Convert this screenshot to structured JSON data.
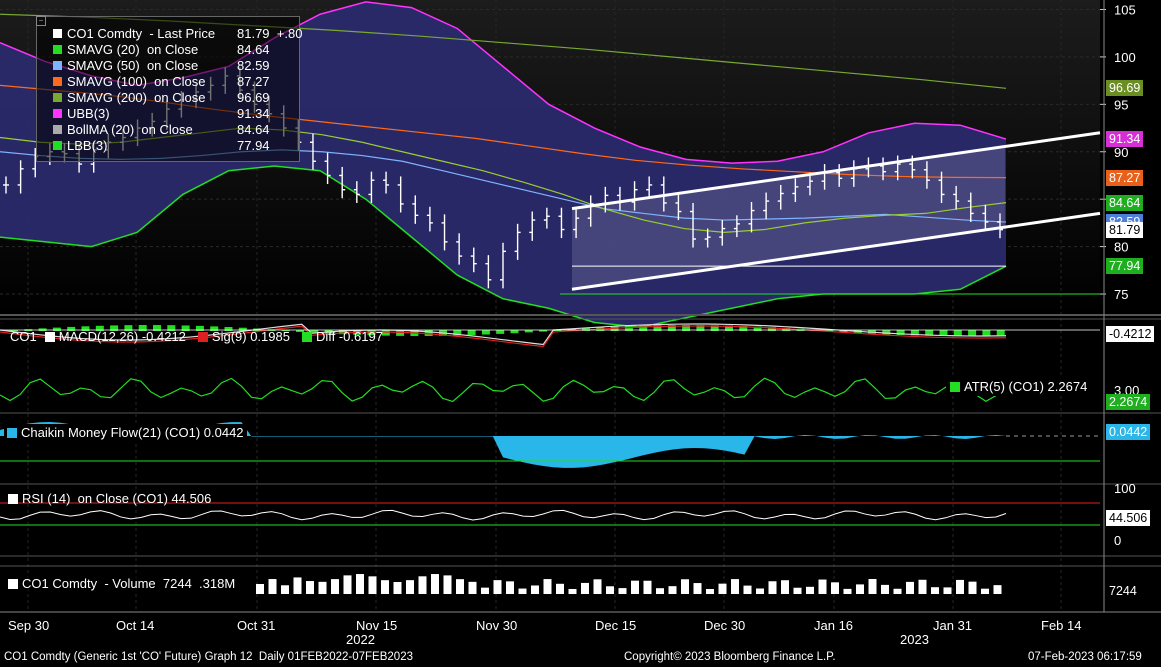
{
  "legend": [
    {
      "label": "CO1 Comdty  - Last Price",
      "value": "81.79  +.80",
      "color": "#ffffff"
    },
    {
      "label": "SMAVG (20)  on Close",
      "value": "84.64",
      "color": "#22dd22"
    },
    {
      "label": "SMAVG (50)  on Close",
      "value": "82.59",
      "color": "#7fb3ff"
    },
    {
      "label": "SMAVG (100)  on Close",
      "value": "87.27",
      "color": "#ff6a1a"
    },
    {
      "label": "SMAVG (200)  on Close",
      "value": "96.69",
      "color": "#78a832"
    },
    {
      "label": "UBB(3)",
      "value": "91.34",
      "color": "#ff33ff"
    },
    {
      "label": "BollMA (20)  on Close",
      "value": "84.64",
      "color": "#aaaaaa"
    },
    {
      "label": "LBB(3)",
      "value": "77.94",
      "color": "#22dd22"
    }
  ],
  "price_axis": {
    "ticks": [
      "105",
      "100",
      "95",
      "90",
      "85",
      "80",
      "75"
    ]
  },
  "price_tags": [
    {
      "text": "96.69",
      "bg": "#6b8e23",
      "fg": "#ffffff",
      "value": 96.69
    },
    {
      "text": "91.34",
      "bg": "#d62fd6",
      "fg": "#ffffff",
      "value": 91.34
    },
    {
      "text": "87.27",
      "bg": "#e8601a",
      "fg": "#ffffff",
      "value": 87.27
    },
    {
      "text": "84.64",
      "bg": "#1fae1f",
      "fg": "#ffffff",
      "value": 84.64
    },
    {
      "text": "82.59",
      "bg": "#4d7fd6",
      "fg": "#ffffff",
      "value": 82.59
    },
    {
      "text": "81.79",
      "bg": "#ffffff",
      "fg": "#000000",
      "value": 81.79
    },
    {
      "text": "77.94",
      "bg": "#1fae1f",
      "fg": "#ffffff",
      "value": 77.94
    }
  ],
  "macd": {
    "label_series": "CO1",
    "label_macd": "MACD(12,26) -0.4212",
    "label_sig": "Sig(9) 0.1985",
    "label_diff": "Diff -0.6197",
    "tag": "-0.4212"
  },
  "atr": {
    "label": "ATR(5) (CO1) 2.2674",
    "tag": "2.2674",
    "tick": "3.00"
  },
  "cmf": {
    "label": "Chaikin Money Flow(21) (CO1) 0.0442",
    "tag": "0.0442"
  },
  "rsi": {
    "label": "RSI (14)  on Close (CO1) 44.506",
    "tag": "44.506",
    "ticks": [
      "100",
      "50",
      "0"
    ]
  },
  "volume": {
    "label": "CO1 Comdty  - Volume  7244  .318M",
    "tag": "7244"
  },
  "x_axis": {
    "ticks": [
      "Sep 30",
      "Oct 14",
      "Oct 31",
      "Nov 15",
      "Nov 30",
      "Dec 15",
      "Dec 30",
      "Jan 16",
      "Jan 31",
      "Feb 14"
    ],
    "years": [
      "2022",
      "2023"
    ]
  },
  "footer": {
    "left": "CO1 Comdty (Generic 1st 'CO' Future) Graph 12  Daily 01FEB2022-07FEB2023",
    "center": "Copyright© 2023 Bloomberg Finance L.P.",
    "right": "07-Feb-2023 06:17:59"
  },
  "colors": {
    "band_fill": "#2b2a6b",
    "ubb": "#ff33ff",
    "lbb": "#22dd22",
    "sma50": "#7fb3ff",
    "sma100": "#ff6a1a",
    "sma200": "#78a832",
    "sma20": "#9acd32",
    "channel": "#ffffff",
    "cmf": "#29b6e8"
  },
  "chart_data": {
    "type": "candlestick",
    "x_dates": [
      "Sep 30",
      "Oct 14",
      "Oct 31",
      "Nov 15",
      "Nov 30",
      "Dec 15",
      "Dec 30",
      "Jan 16",
      "Jan 31",
      "Feb 14"
    ],
    "y_range": [
      73,
      106
    ],
    "close": [
      86.5,
      88.2,
      89.5,
      90.0,
      89.8,
      88.7,
      90.2,
      91.0,
      91.5,
      92.5,
      93.2,
      94.5,
      95.5,
      96.3,
      97.0,
      98.0,
      96.5,
      95.0,
      94.0,
      92.5,
      91.0,
      89.0,
      87.5,
      86.0,
      85.5,
      87.0,
      86.5,
      84.5,
      83.3,
      82.5,
      80.5,
      79.0,
      78.2,
      76.5,
      79.5,
      81.5,
      82.8,
      83.2,
      81.8,
      83.0,
      84.5,
      85.4,
      84.7,
      86.0,
      86.5,
      84.6,
      83.7,
      80.8,
      81.0,
      81.9,
      82.4,
      83.8,
      84.8,
      85.6,
      86.3,
      86.9,
      87.8,
      87.2,
      88.2,
      88.5,
      87.9,
      88.7,
      88.1,
      87.0,
      85.5,
      84.8,
      83.5,
      82.6,
      81.79
    ],
    "sma20": [
      91.5,
      91.0,
      90.8,
      91.0,
      91.5,
      92.0,
      92.5,
      92.3,
      91.8,
      91.0,
      90.0,
      89.0,
      88.0,
      86.8,
      85.5,
      84.0,
      82.8,
      81.9,
      81.5,
      81.8,
      82.5,
      83.0,
      83.3,
      83.5,
      84.1,
      84.64
    ],
    "sma50": [
      90.0,
      89.6,
      89.3,
      89.2,
      89.3,
      89.6,
      90.0,
      90.2,
      90.0,
      89.6,
      89.0,
      88.0,
      87.0,
      86.0,
      85.0,
      84.0,
      83.5,
      83.0,
      82.8,
      82.9,
      83.0,
      83.2,
      83.4,
      83.1,
      82.8,
      82.59
    ],
    "sma100": [
      97.0,
      96.5,
      96.0,
      95.3,
      94.5,
      93.8,
      93.2,
      92.6,
      92.0,
      91.4,
      90.6,
      89.8,
      89.1,
      88.6,
      88.2,
      87.9,
      87.6,
      87.4,
      87.3,
      87.27
    ],
    "sma200": [
      104.5,
      104.2,
      103.8,
      103.3,
      102.8,
      102.2,
      101.5,
      100.8,
      100.0,
      99.2,
      98.4,
      97.6,
      96.69
    ],
    "ubb": [
      101.5,
      99.5,
      98.0,
      97.0,
      97.8,
      99.0,
      102.0,
      104.5,
      105.8,
      105.2,
      103.0,
      99.0,
      95.0,
      92.5,
      90.5,
      89.2,
      88.8,
      89.0,
      90.0,
      92.0,
      93.0,
      92.8,
      91.34
    ],
    "lbb": [
      81.0,
      80.5,
      80.0,
      81.5,
      85.5,
      88.0,
      88.5,
      88.0,
      85.0,
      81.0,
      77.0,
      74.5,
      73.5,
      72.0,
      71.5,
      72.5,
      73.5,
      74.5,
      75.0,
      75.0,
      75.0,
      75.5,
      77.94
    ],
    "channel_upper": [
      [
        0,
        84.0
      ],
      [
        1,
        92.0
      ]
    ],
    "channel_lower": [
      [
        0,
        75.5
      ],
      [
        1,
        83.5
      ]
    ],
    "macd": {
      "macd": -0.4212,
      "signal": 0.1985,
      "diff": -0.6197
    },
    "atr": 2.2674,
    "cmf": 0.0442,
    "rsi": 44.506,
    "volume": 7244
  }
}
